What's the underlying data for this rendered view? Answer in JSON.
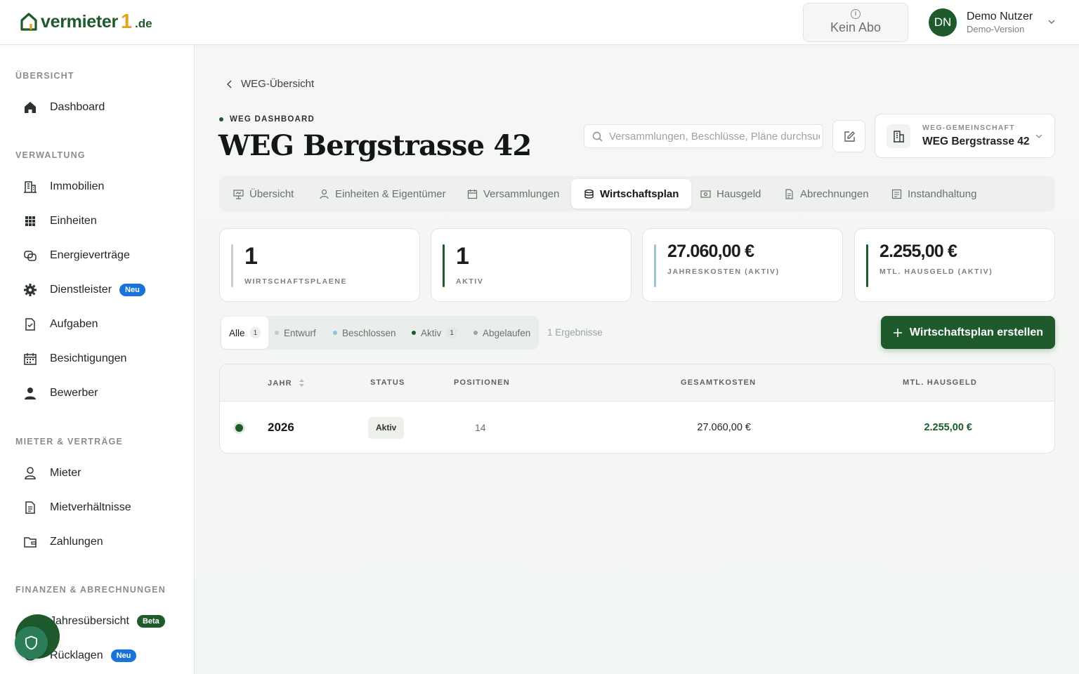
{
  "brand": {
    "name": "vermieter",
    "one": "1",
    "tld": ".de"
  },
  "header": {
    "subscription_label": "Kein Abo",
    "user": {
      "initials": "DN",
      "name": "Demo Nutzer",
      "subtitle": "Demo-Version"
    }
  },
  "sidebar": {
    "sections": [
      {
        "title": "ÜBERSICHT",
        "items": [
          {
            "label": "Dashboard",
            "icon": "home-icon"
          }
        ]
      },
      {
        "title": "VERWALTUNG",
        "items": [
          {
            "label": "Immobilien",
            "icon": "building-icon"
          },
          {
            "label": "Einheiten",
            "icon": "grid-icon"
          },
          {
            "label": "Energieverträge",
            "icon": "energy-contract-icon"
          },
          {
            "label": "Dienstleister",
            "icon": "gear-icon",
            "badge": "Neu"
          },
          {
            "label": "Aufgaben",
            "icon": "task-icon"
          },
          {
            "label": "Besichtigungen",
            "icon": "calendar-icon"
          },
          {
            "label": "Bewerber",
            "icon": "person-icon"
          }
        ]
      },
      {
        "title": "MIETER & VERTRÄGE",
        "items": [
          {
            "label": "Mieter",
            "icon": "user-outline-icon"
          },
          {
            "label": "Mietverhältnisse",
            "icon": "document-icon"
          },
          {
            "label": "Zahlungen",
            "icon": "wallet-icon"
          }
        ]
      },
      {
        "title": "FINANZEN & ABRECHNUNGEN",
        "items": [
          {
            "label": "Jahresübersicht",
            "icon": "chart-icon",
            "badge": "Beta"
          },
          {
            "label": "Rücklagen",
            "icon": "piggy-icon",
            "badge": "Neu"
          }
        ]
      }
    ]
  },
  "main": {
    "back_label": "WEG-Übersicht",
    "eyebrow": "WEG DASHBOARD",
    "title": "WEG Bergstrasse 42",
    "search_placeholder": "Versammlungen, Beschlüsse, Pläne durchsuchen",
    "community": {
      "label": "WEG-GEMEINSCHAFT",
      "value": "WEG Bergstrasse 42"
    },
    "tabs": [
      {
        "label": "Übersicht",
        "icon": "chart-board-icon"
      },
      {
        "label": "Einheiten & Eigentümer",
        "icon": "user-outline-icon"
      },
      {
        "label": "Versammlungen",
        "icon": "calendar-icon"
      },
      {
        "label": "Wirtschaftsplan",
        "icon": "database-icon",
        "active": true
      },
      {
        "label": "Hausgeld",
        "icon": "money-icon"
      },
      {
        "label": "Abrechnungen",
        "icon": "document-icon"
      },
      {
        "label": "Instandhaltung",
        "icon": "checklist-icon"
      }
    ],
    "stats": [
      {
        "value": "1",
        "label": "WIRTSCHAFTSPLAENE",
        "accent": "#c9ccc8"
      },
      {
        "value": "1",
        "label": "AKTIV",
        "accent": "#1e5a2b"
      },
      {
        "value": "27.060,00 €",
        "label": "JAHRESKOSTEN (AKTIV)",
        "accent": "#9cc4d6"
      },
      {
        "value": "2.255,00 €",
        "label": "MTL. HAUSGELD (AKTIV)",
        "accent": "#1e5a2b"
      }
    ],
    "filters": [
      {
        "label": "Alle",
        "count": "1",
        "active": true
      },
      {
        "label": "Entwurf",
        "dot": "#c6c9c5"
      },
      {
        "label": "Beschlossen",
        "dot": "#8fc0d6"
      },
      {
        "label": "Aktiv",
        "dot": "#1e5a2b",
        "count": "1"
      },
      {
        "label": "Abgelaufen",
        "dot": "#9ea39f"
      }
    ],
    "result_count": "1 Ergebnisse",
    "create_button": "Wirtschaftsplan erstellen",
    "table": {
      "columns": [
        "JAHR",
        "STATUS",
        "POSITIONEN",
        "GESAMTKOSTEN",
        "MTL. HAUSGELD"
      ],
      "rows": [
        {
          "jahr": "2026",
          "status": "Aktiv",
          "positionen": "14",
          "gesamtkosten": "27.060,00 €",
          "hausgeld": "2.255,00 €"
        }
      ]
    }
  }
}
